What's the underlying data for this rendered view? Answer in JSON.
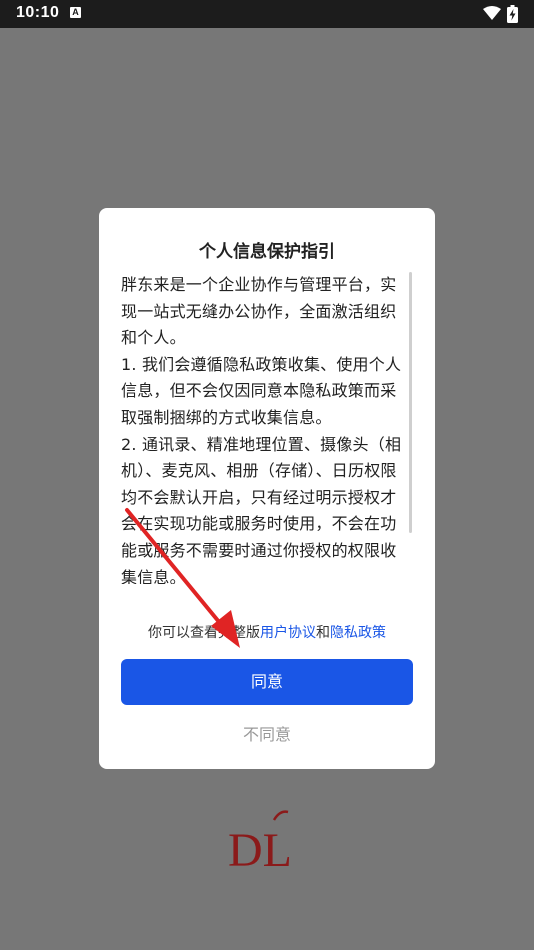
{
  "statusbar": {
    "time": "10:10",
    "notification_glyph": "A",
    "icons": [
      "wifi-icon",
      "battery-charging-icon"
    ]
  },
  "dialog": {
    "title": "个人信息保护指引",
    "paragraphs": [
      "胖东来是一个企业协作与管理平台，实现一站式无缝办公协作，全面激活组织和个人。",
      "1. 我们会遵循隐私政策收集、使用个人信息，但不会仅因同意本隐私政策而采取强制捆绑的方式收集信息。",
      "2. 通讯录、精准地理位置、摄像头（相机）、麦克风、相册（存储）、日历权限均不会默认开启，只有经过明示授权才会在实现功能或服务时使用，不会在功能或服务不需要时通过你授权的权限收集信息。"
    ],
    "links_line": {
      "prefix": "你可以查看完整版",
      "user_agreement": "用户协议",
      "conjunction": "和",
      "privacy_policy": "隐私政策"
    },
    "agree_label": "同意",
    "disagree_label": "不同意"
  },
  "logo": {
    "text": "DL"
  },
  "colors": {
    "accent": "#1a56e6",
    "overlay": "#777777",
    "logo": "#8b1a1a",
    "arrow": "#e02424"
  }
}
